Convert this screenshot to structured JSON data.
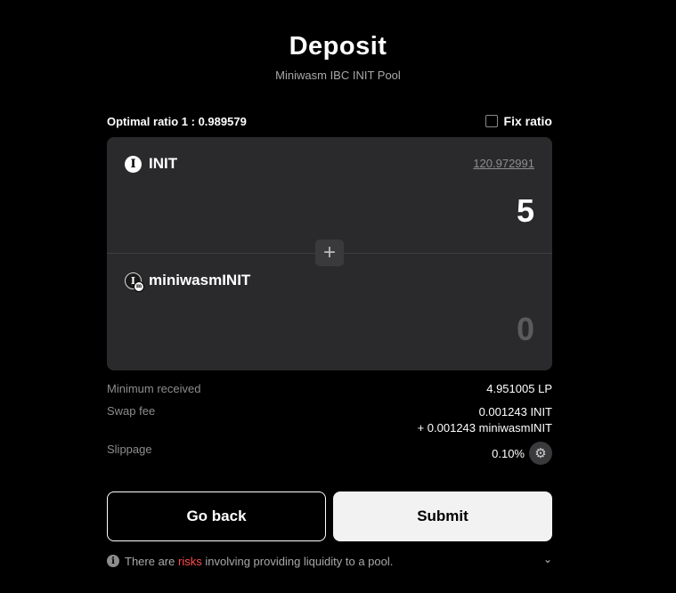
{
  "header": {
    "title": "Deposit",
    "subtitle": "Miniwasm IBC INIT Pool"
  },
  "ratio": {
    "label": "Optimal ratio 1 : 0.989579",
    "fix_label": "Fix ratio",
    "fix_checked": false
  },
  "tokens": [
    {
      "symbol": "INIT",
      "icon": "init-token-icon",
      "balance": "120.972991",
      "amount": "5"
    },
    {
      "symbol": "miniwasmINIT",
      "icon": "miniwasm-init-token-icon",
      "amount": "0"
    }
  ],
  "add_icon": "plus-icon",
  "summary": {
    "min_received_label": "Minimum received",
    "min_received_value": "4.951005",
    "min_received_unit": "LP",
    "swap_fee_label": "Swap fee",
    "swap_fee_1_value": "0.001243",
    "swap_fee_1_unit": "INIT",
    "swap_fee_2_prefix": "+",
    "swap_fee_2_value": "0.001243",
    "swap_fee_2_unit": "miniwasmINIT",
    "slippage_label": "Slippage",
    "slippage_value": "0.10%",
    "settings_icon": "gear-icon"
  },
  "actions": {
    "back_label": "Go back",
    "submit_label": "Submit"
  },
  "risk": {
    "prefix": "There are",
    "highlight": "risks",
    "suffix": "involving providing liquidity to a pool.",
    "highlight_color": "#ff4d4d"
  }
}
